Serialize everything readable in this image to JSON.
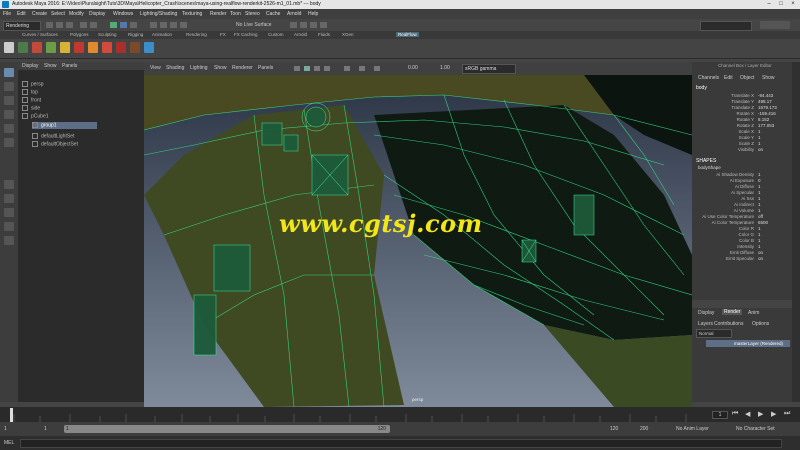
{
  "window": {
    "title": "Autodesk Maya 2016: E:\\Video\\Pluralsight\\Tuts\\3D\\Maya\\Helicopter_Crash\\scenes\\maya-using-realflow-renderkit-2526-m1_01.mb* --- body"
  },
  "menubar": {
    "items": [
      "File",
      "Edit",
      "Create",
      "Select",
      "Modify",
      "Display",
      "Windows",
      "Lighting/Shading",
      "Texturing",
      "Render",
      "Toon",
      "Stereo",
      "Cache",
      "Arnold",
      "Help"
    ]
  },
  "statusline": {
    "mode": "Rendering",
    "live_surface": "No Live Surface"
  },
  "shelf": {
    "tabs": [
      "Curves / Surfaces",
      "Polygons",
      "Sculpting",
      "Rigging",
      "Animation",
      "Rendering",
      "FX",
      "FX Caching",
      "Custom",
      "Arnold",
      "Fluids",
      "XGen",
      "RealFlow"
    ],
    "active": "RealFlow"
  },
  "outliner": {
    "menu": [
      "Display",
      "Show",
      "Panels"
    ],
    "items": [
      "persp",
      "top",
      "front",
      "side",
      "pCube1",
      "group1",
      "defaultLightSet",
      "defaultObjectSet"
    ],
    "selected": "group1"
  },
  "viewport": {
    "menu": [
      "View",
      "Shading",
      "Lighting",
      "Show",
      "Renderer",
      "Panels"
    ],
    "exposure": "0.00",
    "gamma": "1.00",
    "color_space": "sRGB gamma",
    "camera_label": "persp",
    "watermark": "www.cgtsj.com"
  },
  "channelbox": {
    "tabs": [
      "Channel Box / Layer Editor"
    ],
    "menu": [
      "Channels",
      "Edit",
      "Object",
      "Show"
    ],
    "object": "body",
    "attributes": [
      {
        "name": "Translate X",
        "value": "-94.443"
      },
      {
        "name": "Translate Y",
        "value": "498.17"
      },
      {
        "name": "Translate Z",
        "value": "1579.173"
      },
      {
        "name": "Rotate X",
        "value": "-159.416"
      },
      {
        "name": "Rotate Y",
        "value": "8.152"
      },
      {
        "name": "Rotate Z",
        "value": "177.053"
      },
      {
        "name": "Scale X",
        "value": "1"
      },
      {
        "name": "Scale Y",
        "value": "1"
      },
      {
        "name": "Scale Z",
        "value": "1"
      },
      {
        "name": "Visibility",
        "value": "on"
      }
    ],
    "shapes_label": "SHAPES",
    "shape_name": "bodyShape",
    "shape_attributes": [
      {
        "name": "Ai Shadow Density",
        "value": "1"
      },
      {
        "name": "Ai Exposure",
        "value": "0"
      },
      {
        "name": "Ai Diffuse",
        "value": "1"
      },
      {
        "name": "Ai Specular",
        "value": "1"
      },
      {
        "name": "Ai Sss",
        "value": "1"
      },
      {
        "name": "Ai Indirect",
        "value": "1"
      },
      {
        "name": "Ai Volume",
        "value": "1"
      },
      {
        "name": "Ai Use Color Temperature",
        "value": "off"
      },
      {
        "name": "Ai Color Temperature",
        "value": "6500"
      },
      {
        "name": "Color R",
        "value": "1"
      },
      {
        "name": "Color G",
        "value": "1"
      },
      {
        "name": "Color B",
        "value": "1"
      },
      {
        "name": "Intensity",
        "value": "1"
      },
      {
        "name": "Emit Diffuse",
        "value": "on"
      },
      {
        "name": "Emit Specular",
        "value": "on"
      }
    ]
  },
  "layers": {
    "tabs": [
      "Display",
      "Render",
      "Anim"
    ],
    "active_tab": "Render",
    "menu": [
      "Layers",
      "Contributions",
      "Options"
    ],
    "mode": "Normal",
    "layer_name": "masterLayer (Rendered)"
  },
  "timeline": {
    "start": "1",
    "ticks": [
      "5",
      "10",
      "15",
      "20",
      "25",
      "30",
      "35",
      "40",
      "45",
      "50",
      "55",
      "60",
      "65",
      "70",
      "75",
      "80",
      "85",
      "90",
      "95",
      "100",
      "105",
      "110",
      "115",
      "120"
    ],
    "current": "1"
  },
  "range": {
    "start": "1",
    "range_start": "1",
    "range_end": "120",
    "end": "120",
    "anim_end": "200",
    "anim_layer": "No Anim Layer",
    "char_set": "No Character Set"
  },
  "cmdline": {
    "label": "MEL"
  }
}
